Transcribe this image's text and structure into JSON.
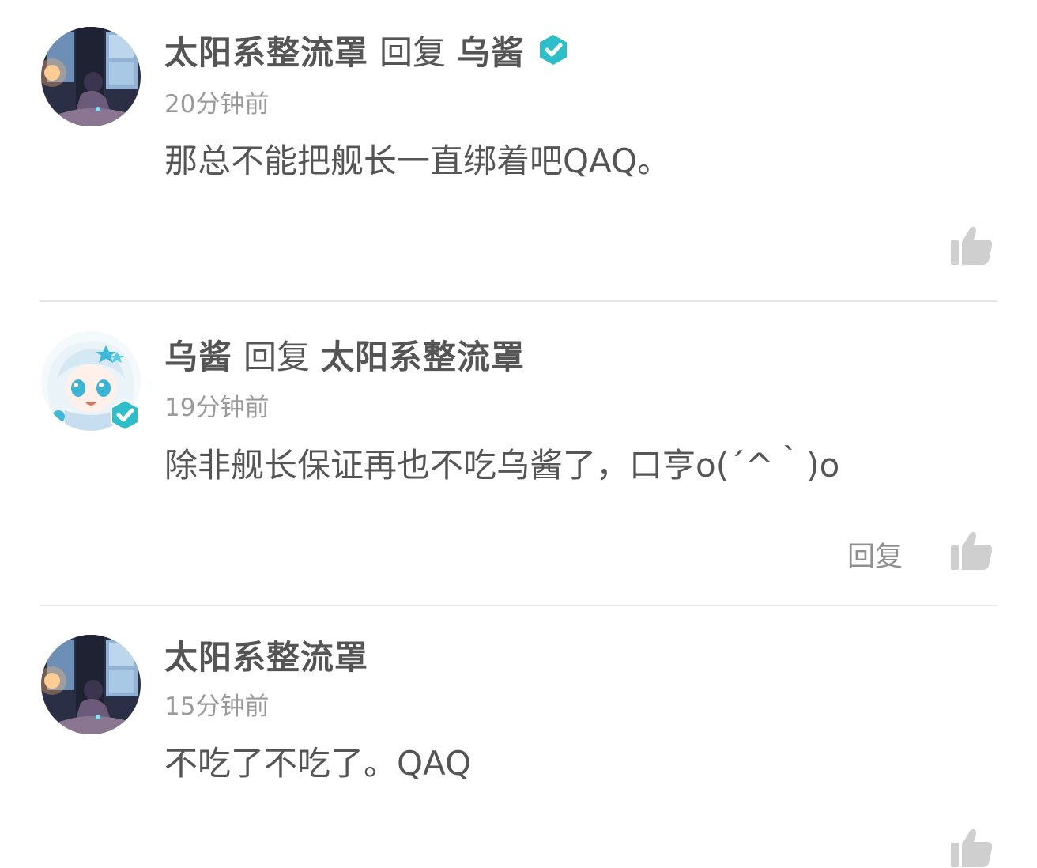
{
  "comments": [
    {
      "author": "太阳系整流罩",
      "reply_label": "回复",
      "reply_to": "乌酱",
      "reply_to_verified": true,
      "time": "20分钟前",
      "text": "那总不能把舰长一直绑着吧QAQ。",
      "avatar": "night-window-girl-avatar",
      "show_reply_button": false
    },
    {
      "author": "乌酱",
      "reply_label": "回复",
      "reply_to": "太阳系整流罩",
      "author_verified": true,
      "time": "19分钟前",
      "text": "除非舰长保证再也不吃乌酱了，口亨o(´^｀)o",
      "avatar": "white-hair-chibi-avatar",
      "show_reply_button": true,
      "reply_button_label": "回复"
    },
    {
      "author": "太阳系整流罩",
      "time": "15分钟前",
      "text": "不吃了不吃了。QAQ",
      "avatar": "night-window-girl-avatar",
      "show_reply_button": false
    }
  ],
  "colors": {
    "text": "#555555",
    "time": "#9a9a9a",
    "verified": "#2dbfc9",
    "like": "#cfcfcf",
    "divider": "#e6e6e6"
  }
}
